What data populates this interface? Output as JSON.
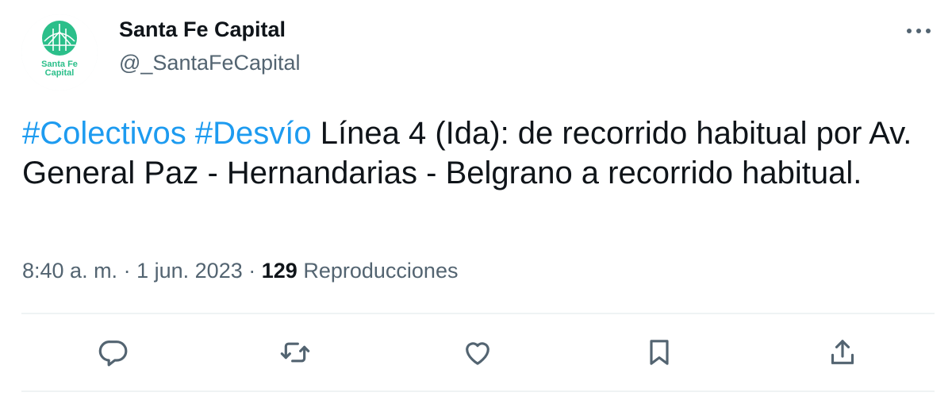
{
  "author": {
    "name": "Santa Fe Capital",
    "handle": "@_SantaFeCapital",
    "avatar_text_line1": "Santa Fe",
    "avatar_text_line2": "Capital"
  },
  "tweet": {
    "hashtags": [
      "#Colectivos",
      "#Desvío"
    ],
    "body": "Línea 4 (Ida): de recorrido habitual por Av. General Paz - Hernandarias - Belgrano a recorrido habitual."
  },
  "meta": {
    "time": "8:40 a. m.",
    "separator": "·",
    "date": "1 jun. 2023",
    "views_count": "129",
    "views_label": "Reproducciones"
  },
  "icons": {
    "more": "more-icon",
    "reply": "reply-icon",
    "retweet": "retweet-icon",
    "like": "like-icon",
    "bookmark": "bookmark-icon",
    "share": "share-icon"
  },
  "colors": {
    "accent": "#1d9bf0",
    "brand_green": "#2bbf8a",
    "secondary_text": "#536471",
    "primary_text": "#0f1419"
  }
}
